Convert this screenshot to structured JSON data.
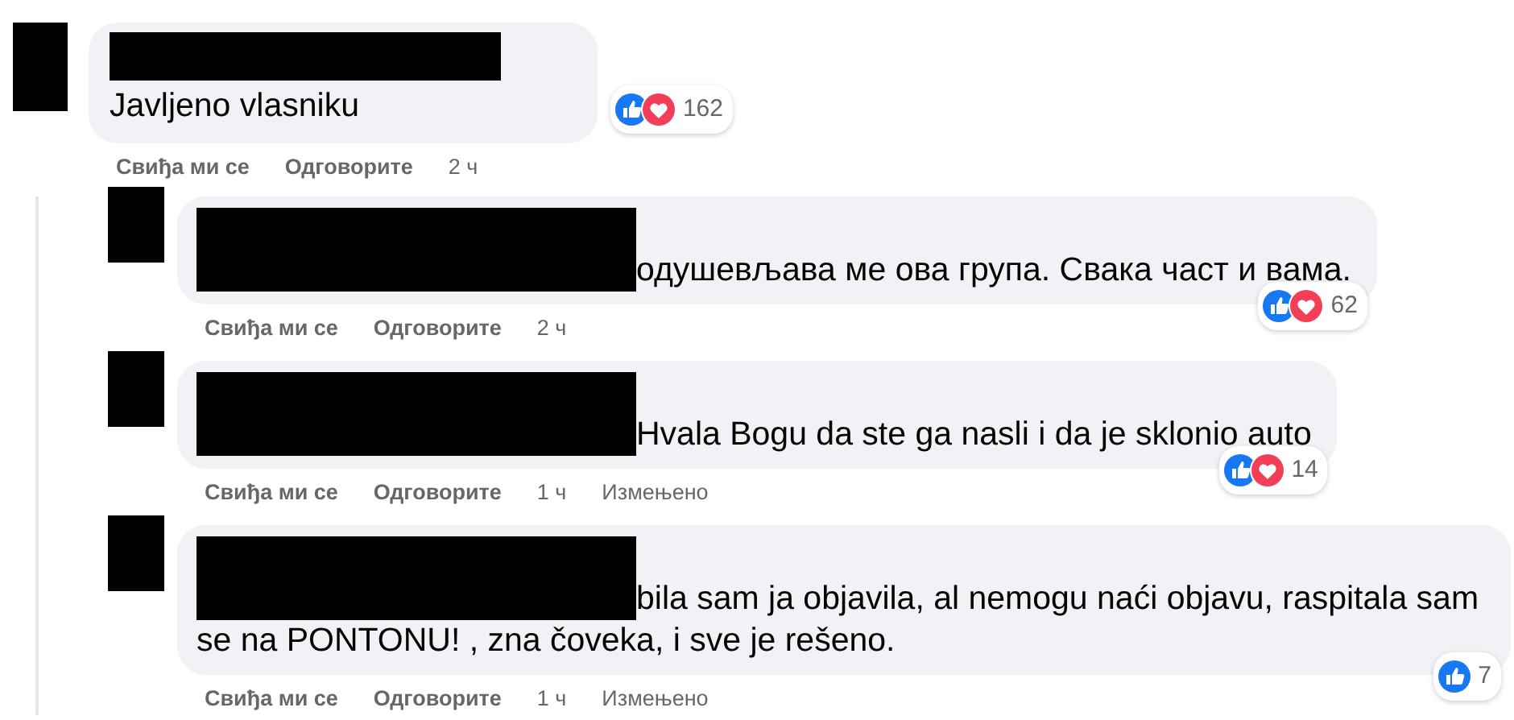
{
  "comments": [
    {
      "text": "Javljeno vlasniku",
      "reactions": {
        "like": true,
        "love": true,
        "count": "162"
      },
      "actions": {
        "like": "Свиђа ми се",
        "reply": "Одговорите",
        "time": "2 ч"
      },
      "replies": [
        {
          "text": "одушевљава ме ова група. Свака част и вама.",
          "reactions": {
            "like": true,
            "love": true,
            "count": "62"
          },
          "actions": {
            "like": "Свиђа ми се",
            "reply": "Одговорите",
            "time": "2 ч"
          }
        },
        {
          "text": "Hvala Bogu da ste ga nasli i da je sklonio auto",
          "reactions": {
            "like": true,
            "love": true,
            "count": "14"
          },
          "actions": {
            "like": "Свиђа ми се",
            "reply": "Одговорите",
            "time": "1 ч",
            "edited": "Измењено"
          }
        },
        {
          "text": "bila sam ja objavila, al nemogu naći objavu, raspitala sam se na PONTONU! , zna čoveka, i sve je rešeno.",
          "reactions": {
            "like": true,
            "love": false,
            "count": "7"
          },
          "actions": {
            "like": "Свиђа ми се",
            "reply": "Одговорите",
            "time": "1 ч",
            "edited": "Измењено"
          }
        }
      ]
    }
  ]
}
